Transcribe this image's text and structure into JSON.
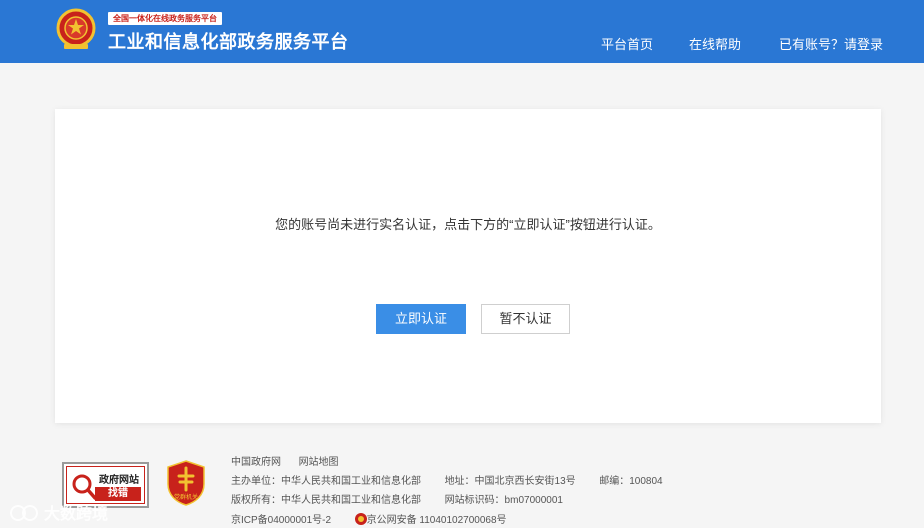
{
  "header": {
    "tag": "全国一体化在线政务服务平台",
    "title": "工业和信息化部政务服务平台",
    "nav": [
      {
        "label": "平台首页"
      },
      {
        "label": "在线帮助"
      },
      {
        "label": "已有账号？请登录"
      }
    ]
  },
  "card": {
    "message": "您的账号尚未进行实名认证，点击下方的“立即认证”按钮进行认证。",
    "primary_button": "立即认证",
    "secondary_button": "暂不认证"
  },
  "footer": {
    "badge": {
      "line1": "政府网站",
      "line2": "找错"
    },
    "police_badge_label": "党群机关",
    "links": [
      "中国政府网",
      "网站地图"
    ],
    "organizer": "主办单位：中华人民共和国工业和信息化部",
    "address": "地址：中国北京西长安街13号",
    "postcode": "邮编：100804",
    "copyright": "版权所有：中华人民共和国工业和信息化部",
    "site_code": "网站标识码：bm07000001",
    "icp": "京ICP备04000001号-2",
    "police_record": "京公网安备 11040102700068号"
  },
  "watermark": {
    "text": "大数跨境"
  },
  "colors": {
    "header_bg": "#2a77d4",
    "primary": "#3a8ee6",
    "accent_red": "#c8221b"
  }
}
